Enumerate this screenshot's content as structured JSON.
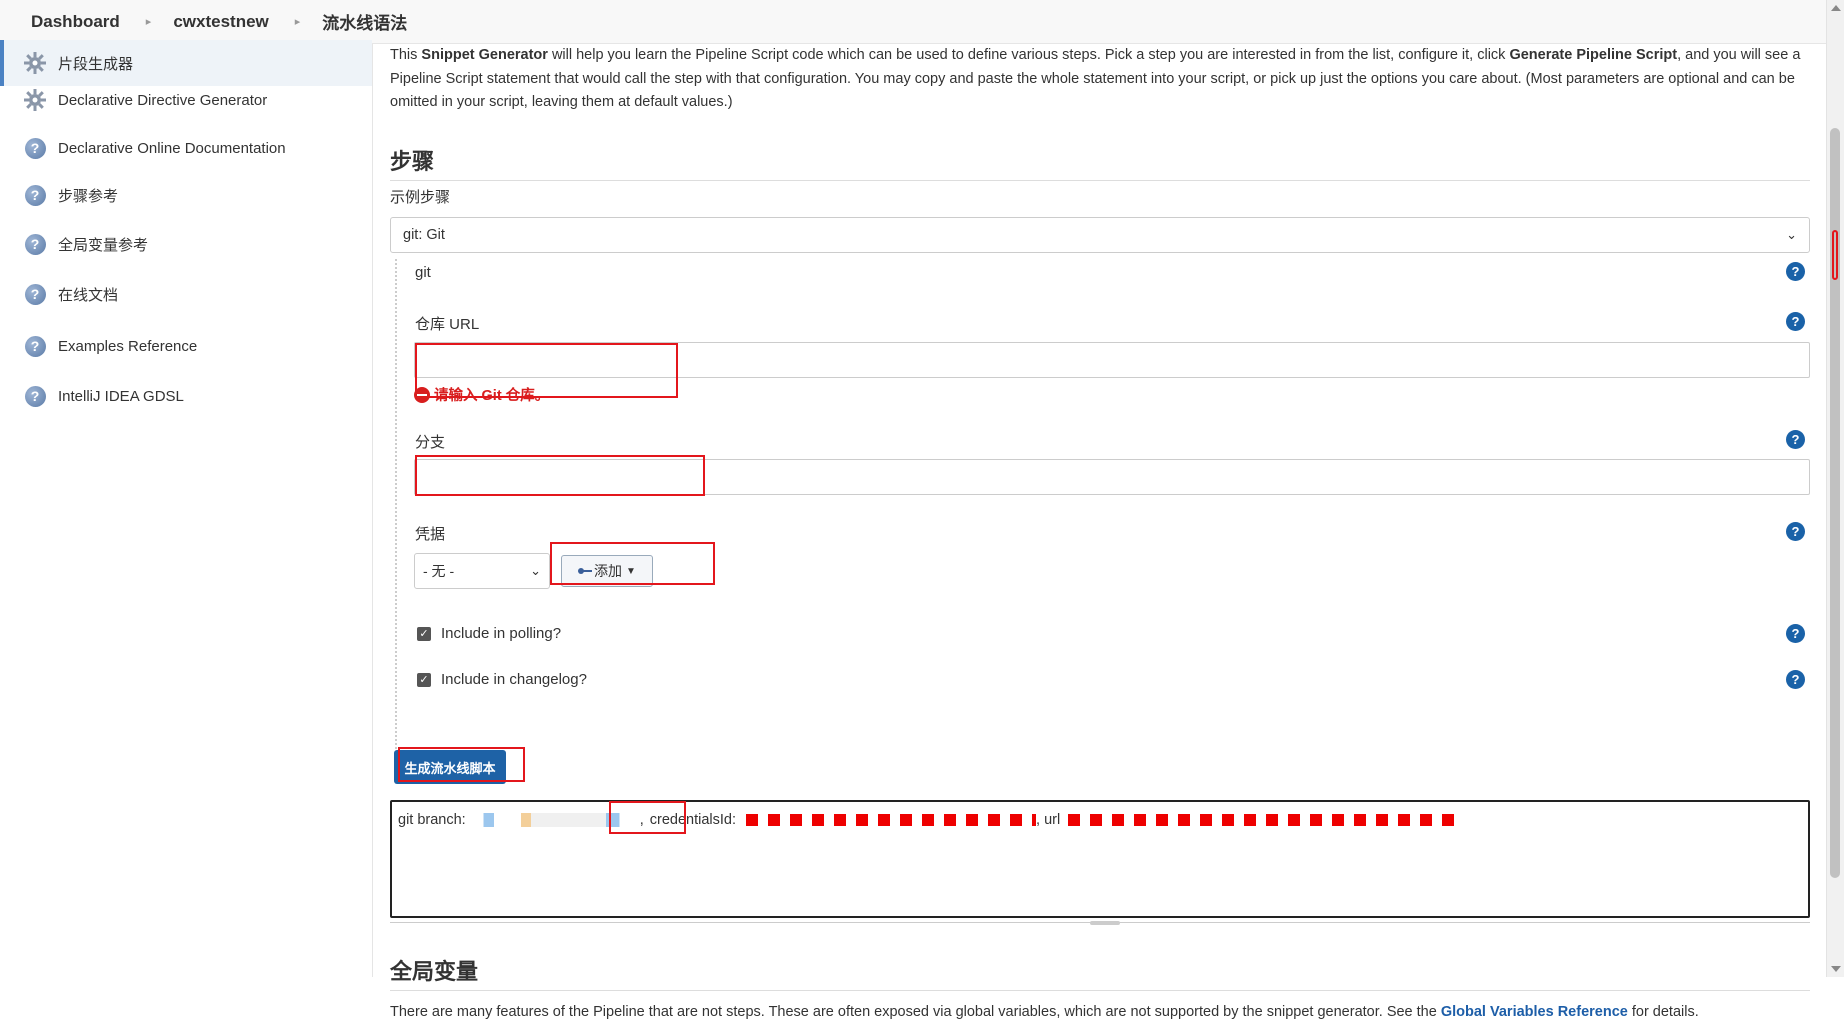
{
  "breadcrumb": {
    "items": [
      "Dashboard",
      "cwxtestnew",
      "流水线语法"
    ]
  },
  "sidebar": {
    "items": [
      {
        "label": "片段生成器",
        "icon": "gear-icon",
        "active": true
      },
      {
        "label": "Declarative Directive Generator",
        "icon": "gear-icon"
      },
      {
        "label": "Declarative Online Documentation",
        "icon": "help-icon"
      },
      {
        "label": "步骤参考",
        "icon": "help-icon"
      },
      {
        "label": "全局变量参考",
        "icon": "help-icon"
      },
      {
        "label": "在线文档",
        "icon": "help-icon"
      },
      {
        "label": "Examples Reference",
        "icon": "help-icon"
      },
      {
        "label": "IntelliJ IDEA GDSL",
        "icon": "help-icon"
      }
    ]
  },
  "intro": {
    "p1": "This ",
    "snippet_generator": "Snippet Generator",
    "p2": " will help you learn the Pipeline Script code which can be used to define various steps. Pick a step you are interested in from the list, configure it, click ",
    "generate_pipeline_script": "Generate Pipeline Script",
    "p3": ", and you will see a Pipeline Script statement that would call the step with that configuration. You may copy and paste the whole statement into your script, or pick up just the options you care about. (Most parameters are optional and can be omitted in your script, leaving them at default values.)"
  },
  "steps": {
    "heading": "步骤",
    "sample_label": "示例步骤",
    "selected": "git: Git"
  },
  "form": {
    "git_label": "git",
    "repo_url_label": "仓库 URL",
    "repo_url_value": "",
    "repo_error": "请输入 Git 仓库。",
    "branch_label": "分支",
    "branch_value": "",
    "credentials_label": "凭据",
    "credentials_selected": "- 无 -",
    "add_button": "添加",
    "include_polling": "Include in polling?",
    "include_changelog": "Include in changelog?",
    "generate_button": "生成流水线脚本"
  },
  "output": {
    "prefix": "git branch: ",
    "credentials": "credentialsId:",
    "url": ", url"
  },
  "globals": {
    "heading": "全局变量",
    "text_before": "There are many features of the Pipeline that are not steps. These are often exposed via global variables, which are not supported by the snippet generator. See the ",
    "link": "Global Variables Reference",
    "text_after": " for details."
  },
  "colors": {
    "accent": "#1e62a6",
    "error": "#d81e1e",
    "highlight_box": "#e3161c"
  }
}
